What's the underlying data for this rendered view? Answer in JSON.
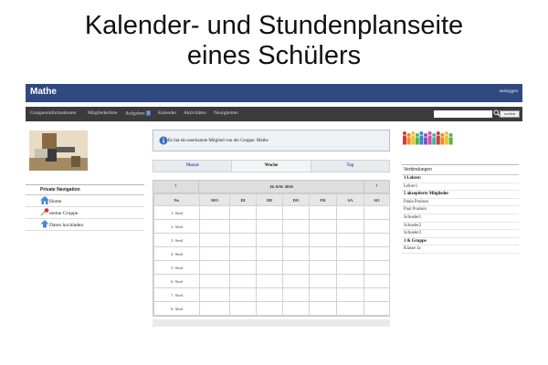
{
  "slide": {
    "title_line1": "Kalender- und Stundenplanseite",
    "title_line2": "eines Schülers"
  },
  "topbar": {
    "app_name": "Mathe",
    "logout": "ausloggen"
  },
  "navbar": {
    "items": [
      {
        "label": "Gruppeninformationen"
      },
      {
        "label": "Mitgliederliste"
      },
      {
        "label": "Aufgaben",
        "badge": "2"
      },
      {
        "label": "Kalender"
      },
      {
        "label": "Aktivitäten"
      },
      {
        "label": "Neuigkeiten"
      }
    ],
    "search_button": "suchen"
  },
  "private_nav": {
    "title": "Private Navigation",
    "items": [
      {
        "label": "Home",
        "icon": "home-icon"
      },
      {
        "label": "meine Gruppe",
        "icon": "pin-icon"
      },
      {
        "label": "Daten hochladen",
        "icon": "upload-icon"
      }
    ]
  },
  "info": {
    "text": "Es hat ein unerkannte Mitglied von der Gruppe: Mathe"
  },
  "view_tabs": [
    "Monat",
    "Woche",
    "Tag"
  ],
  "timetable": {
    "prev": "‹",
    "next": "›",
    "week_label": "16. KW. 2016",
    "headers": [
      "Nr.",
      "MO",
      "DI",
      "MI",
      "DO",
      "FR",
      "SA",
      "SO"
    ],
    "hours": [
      "1. Stnd",
      "2. Stnd",
      "3. Stnd",
      "4. Stnd",
      "5. Stnd",
      "6. Stnd",
      "7. Stnd",
      "8. Stnd"
    ]
  },
  "connections": {
    "title": "Verbindungen",
    "items": [
      {
        "label": "1 Lehrer:",
        "head": true
      },
      {
        "label": "Lehrer1",
        "head": false
      },
      {
        "label": "5 akzeptierte Mitglieder",
        "head": true
      },
      {
        "label": "Paula Poulsen",
        "head": false
      },
      {
        "label": "Paul Poulsen",
        "head": false
      },
      {
        "label": "Schueler1",
        "head": false
      },
      {
        "label": "Schueler2",
        "head": false
      },
      {
        "label": "Schueler3",
        "head": false
      },
      {
        "label": "1 & Gruppe",
        "head": true
      },
      {
        "label": "Klasse 1a",
        "head": false
      }
    ]
  },
  "colors": {
    "topbar": "#2f4a80",
    "navbar": "#3b3b3b",
    "link": "#3b63ad"
  }
}
